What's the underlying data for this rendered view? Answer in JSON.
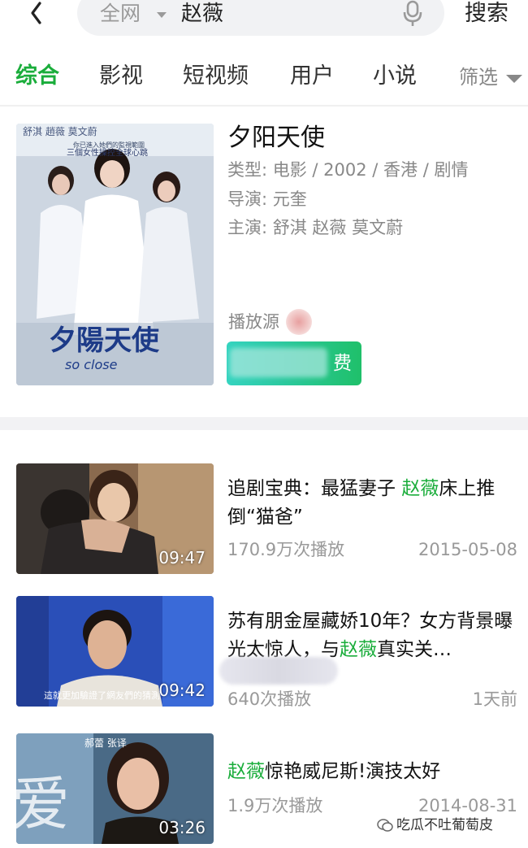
{
  "search": {
    "scope": "全网",
    "query": "赵薇",
    "submit": "搜索"
  },
  "tabs": [
    {
      "label": "综合",
      "active": true
    },
    {
      "label": "影视",
      "active": false
    },
    {
      "label": "短视频",
      "active": false
    },
    {
      "label": "用户",
      "active": false
    },
    {
      "label": "小说",
      "active": false
    }
  ],
  "filter_label": "筛选",
  "movie": {
    "title": "夕阳天使",
    "type_line": "类型: 电影 / 2002 / 香港 / 剧情",
    "director_line": "导演: 元奎",
    "cast_line": "主演: 舒淇   赵薇   莫文蔚",
    "source_label": "播放源",
    "play_button_tail": "费",
    "poster_text": {
      "top_names": "舒淇   趙薇   莫文蔚",
      "tagline1": "你已進入她們的監視範圍",
      "tagline2": "三個女性操控全球心跳",
      "logo": "夕陽天使",
      "logo_en": "so close"
    }
  },
  "videos": [
    {
      "title_before": "追剧宝典：最猛妻子 ",
      "highlight": "赵薇",
      "title_after": "床上推倒“猫爸”",
      "views": "170.9万次播放",
      "date": "2015-05-08",
      "duration": "09:47"
    },
    {
      "title_before": "苏有朋金屋藏娇10年？女方背景曝光太惊人，与",
      "highlight": "赵薇",
      "title_after": "真实关…",
      "views": "640次播放",
      "date": "1天前",
      "duration": "09:42",
      "thumb_caption": "這就更加驗證了網友們的猜測"
    },
    {
      "title_before": "",
      "highlight": "赵薇",
      "title_after": "惊艳威尼斯!演技太好",
      "views": "1.9万次播放",
      "date": "2014-08-31",
      "duration": "03:26",
      "thumb_header": "郝蕾  张译"
    }
  ],
  "watermark": "吃瓜不吐葡萄皮",
  "colors": {
    "accent": "#1aad3b",
    "muted": "#999999",
    "search_bg": "#f1f2f4"
  }
}
